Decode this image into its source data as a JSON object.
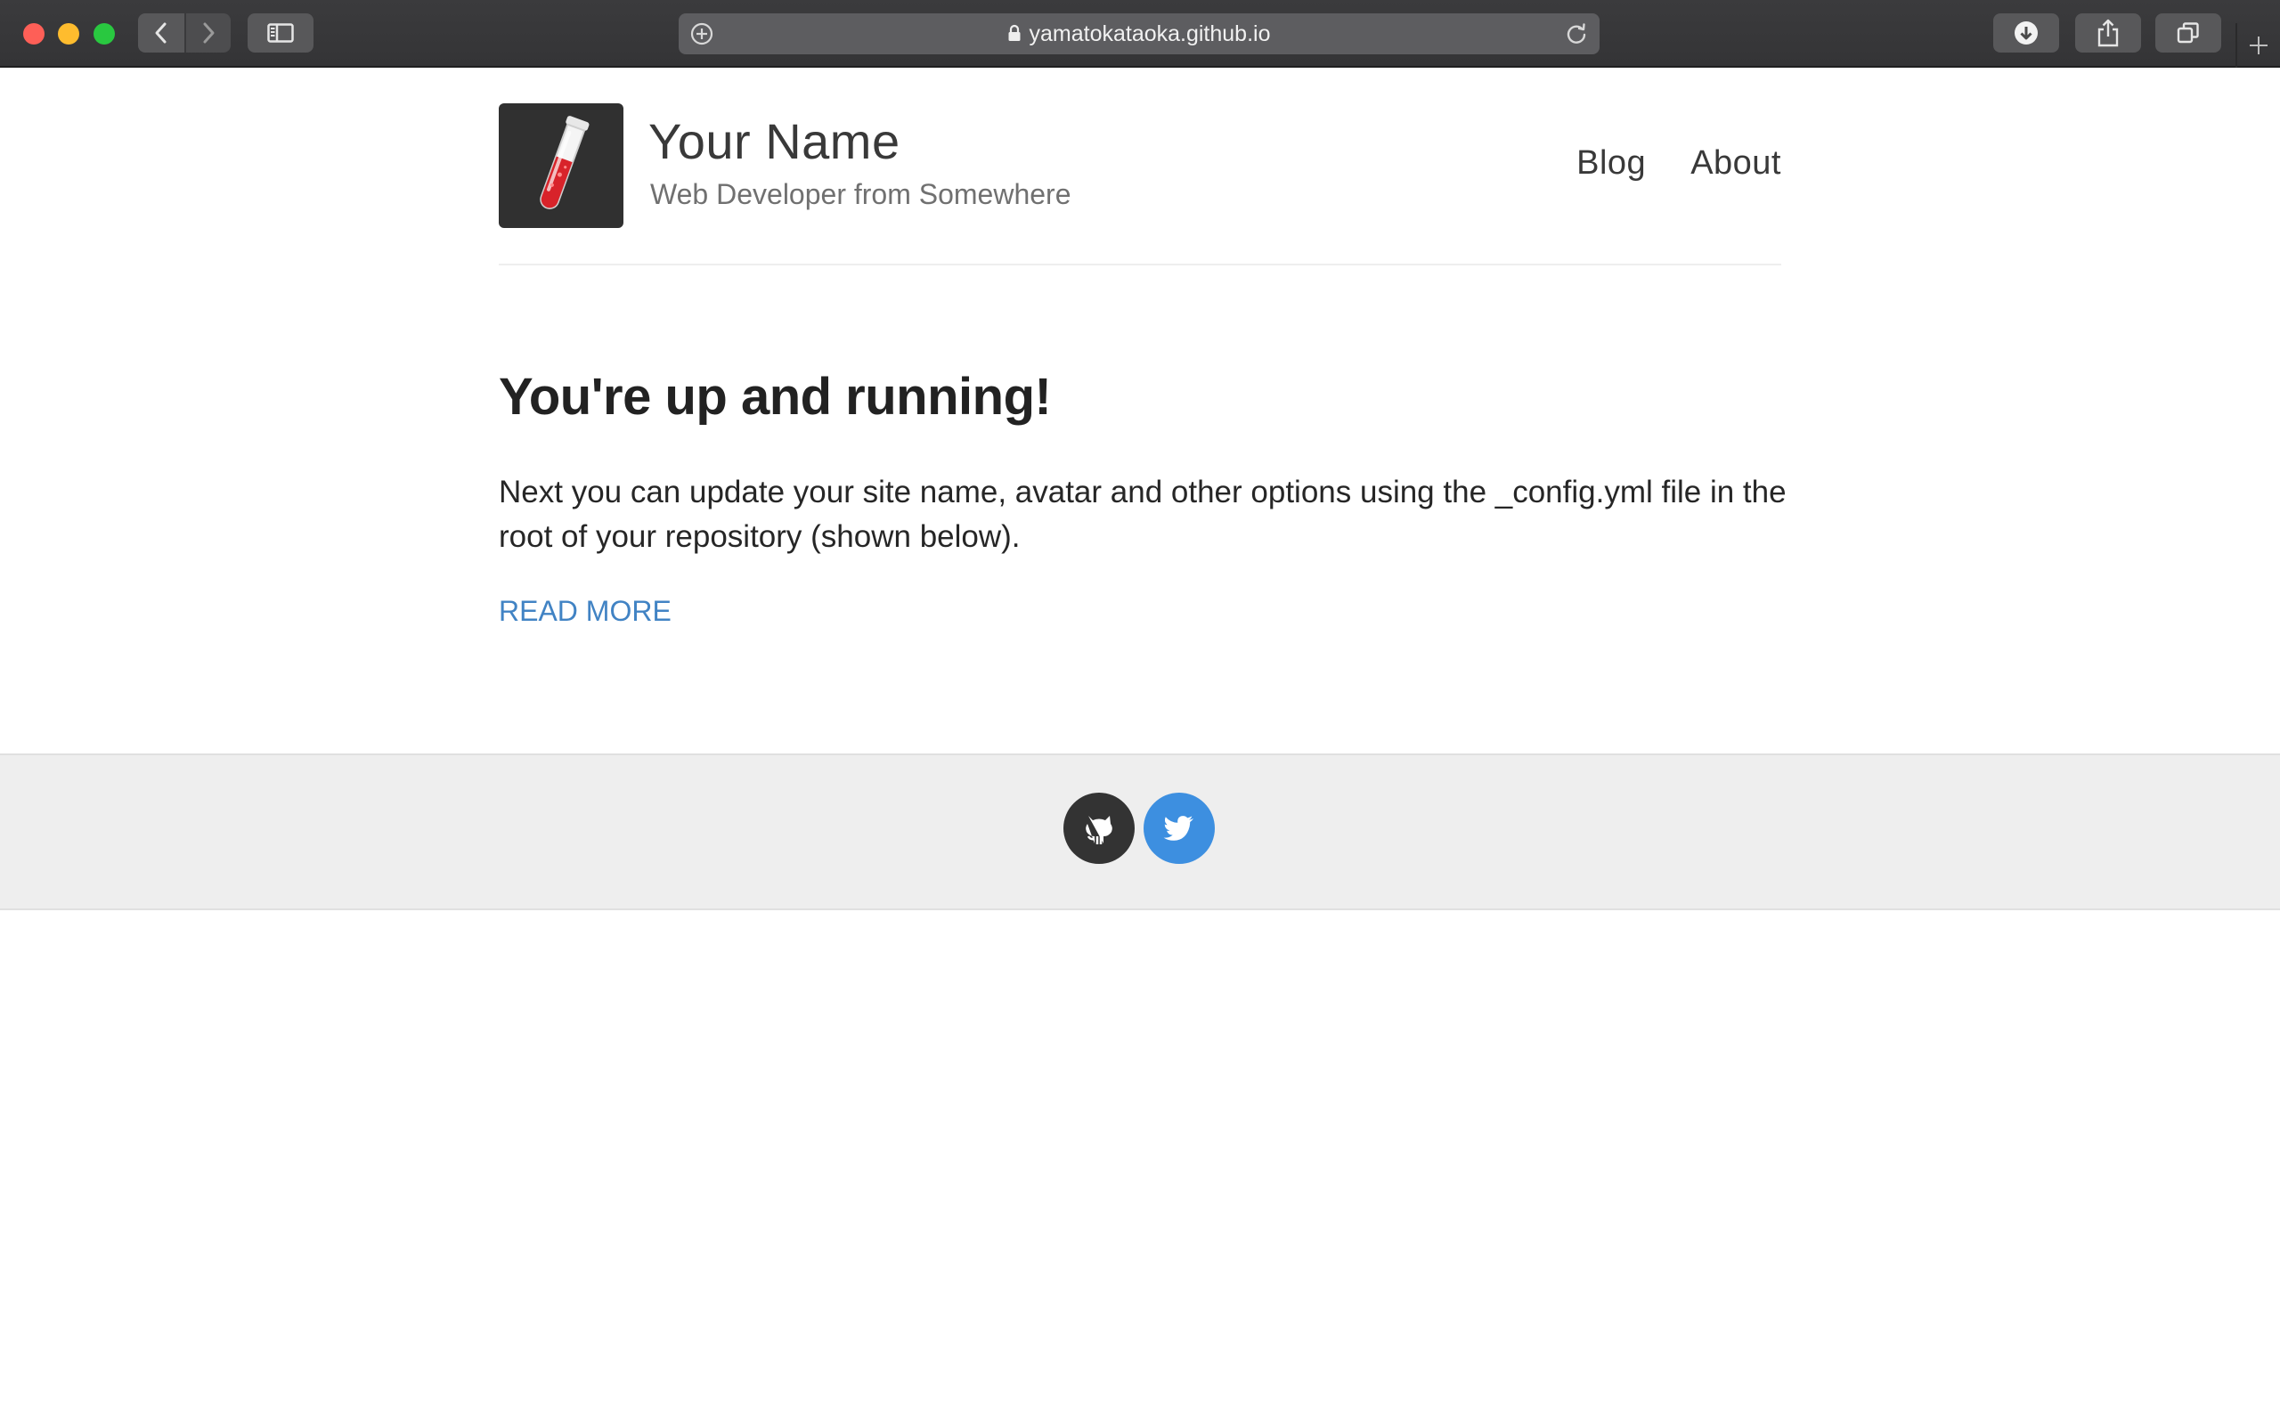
{
  "browser": {
    "url": "yamatokataoka.github.io",
    "icons": [
      "back-icon",
      "forward-icon",
      "sidebar-icon",
      "add-icon",
      "lock-icon",
      "reload-icon",
      "download-icon",
      "share-icon",
      "tabs-icon",
      "new-tab-icon"
    ]
  },
  "site": {
    "name": "Your Name",
    "description": "Web Developer from Somewhere",
    "avatar_icon": "test-tube-icon",
    "nav": [
      "Blog",
      "About"
    ]
  },
  "post": {
    "title": "You're up and running!",
    "excerpt": "Next you can update your site name, avatar and other options using the _config.yml file in the root of your repository (shown below).",
    "read_more": "READ MORE"
  },
  "footer": {
    "social": [
      {
        "icon": "github-icon",
        "color": "#333333"
      },
      {
        "icon": "twitter-icon",
        "color": "#3d8fe0"
      }
    ]
  },
  "colors": {
    "link": "#4183c4",
    "footer_bg": "#eeeeee",
    "chrome_bg": "#38383a"
  }
}
